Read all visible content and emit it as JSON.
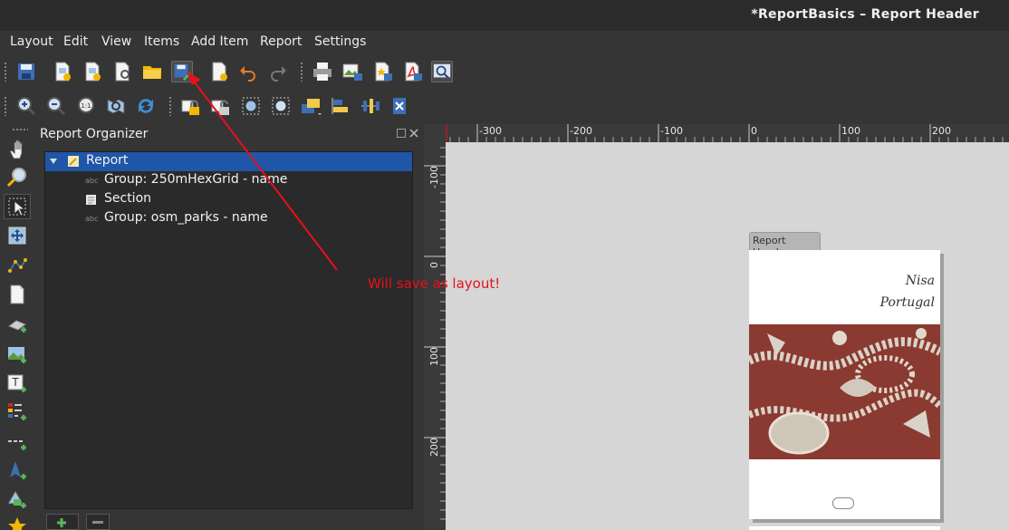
{
  "window": {
    "title": "*ReportBasics – Report Header"
  },
  "menu": [
    "Layout",
    "Edit",
    "View",
    "Items",
    "Add Item",
    "Report",
    "Settings"
  ],
  "toolbar1_icons": [
    "save-icon",
    "new-layout-icon",
    "duplicate-layout-icon",
    "layout-manager-icon",
    "open-template-icon",
    "save-as-template-icon",
    "new-report-icon",
    "undo-icon",
    "redo-icon",
    "print-icon",
    "export-image-icon",
    "export-svg-icon",
    "export-pdf-icon",
    "atlas-preview-icon"
  ],
  "toolbar2_icons": [
    "zoom-in-icon",
    "zoom-out-icon",
    "zoom-actual-icon",
    "zoom-full-icon",
    "refresh-icon",
    "lock-icon",
    "unlock-icon",
    "group-icon",
    "ungroup-icon",
    "raise-icon",
    "align-icon",
    "distribute-icon",
    "resize-icon"
  ],
  "left_tools": [
    "pan-icon",
    "zoom-tool-icon",
    "select-icon",
    "move-content-icon",
    "edit-nodes-icon",
    "add-map-icon",
    "add-3d-map-icon",
    "add-picture-icon",
    "add-label-icon",
    "add-legend-icon",
    "add-scalebar-icon",
    "add-north-arrow-icon",
    "add-shape-icon",
    "add-marker-icon"
  ],
  "organizer": {
    "title": "Report Organizer",
    "items": [
      {
        "label": "Report",
        "kind": "report"
      },
      {
        "label": "Group: 250mHexGrid - name",
        "kind": "group"
      },
      {
        "label": "Section",
        "kind": "section"
      },
      {
        "label": "Group: osm_parks - name",
        "kind": "group"
      }
    ]
  },
  "ruler": {
    "h_labels": [
      "-300",
      "-200",
      "-100",
      "0",
      "100",
      "200"
    ],
    "v_labels": [
      "-100",
      "0",
      "100",
      "200"
    ]
  },
  "page": {
    "tab_label": "Report Header",
    "title_line1": "Nisa",
    "title_line2": "Portugal"
  },
  "annotation": {
    "text": "Will save as layout!"
  },
  "colors": {
    "accent": "#2056a8",
    "annotation": "#e8101a",
    "background": "#353535"
  }
}
